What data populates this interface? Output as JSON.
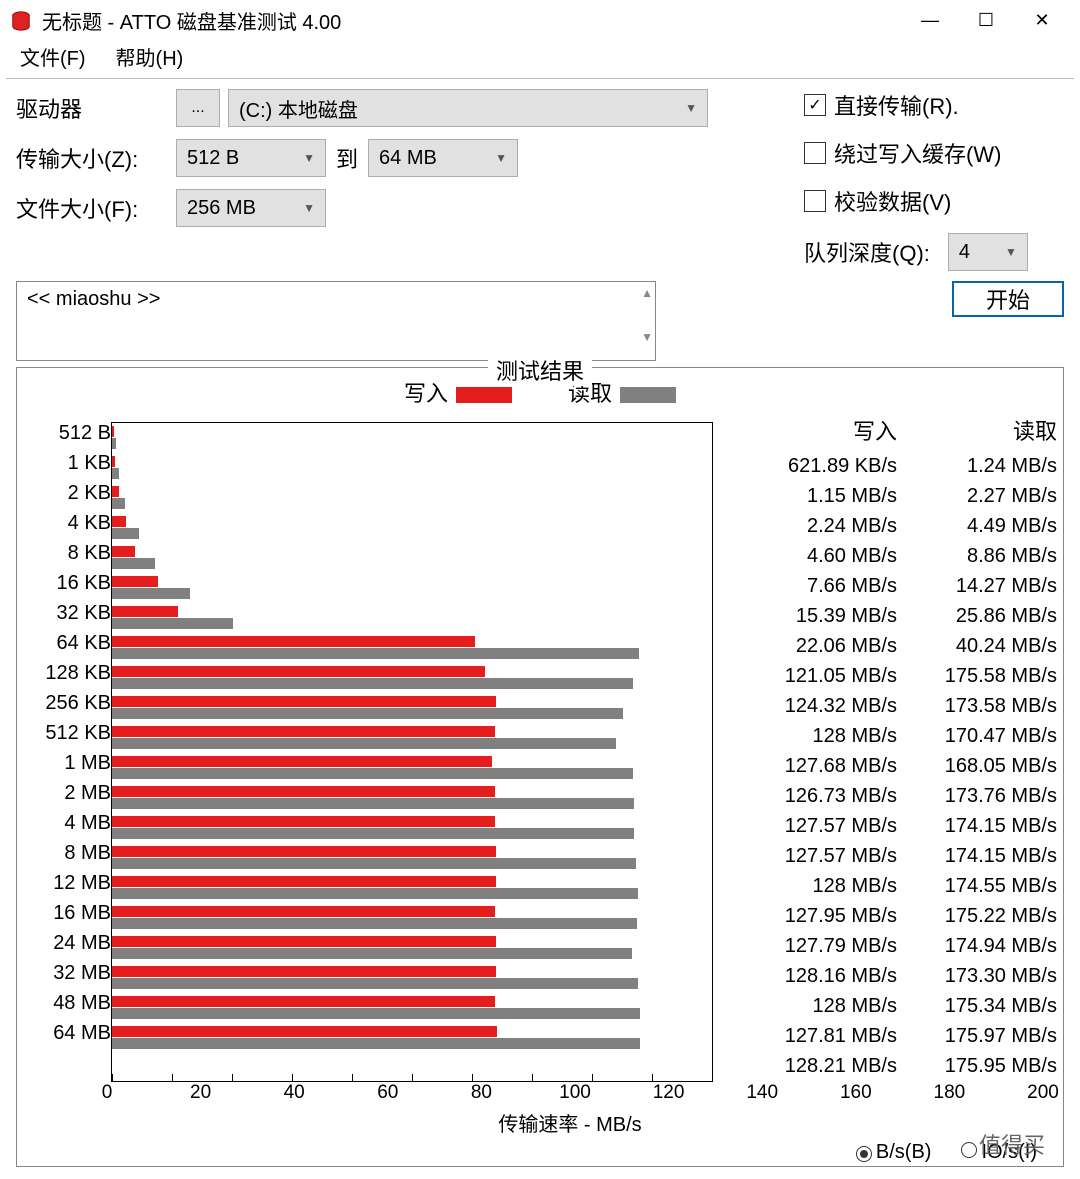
{
  "title": "无标题 - ATTO 磁盘基准测试 4.00",
  "menu": {
    "file": "文件(F)",
    "help": "帮助(H)"
  },
  "labels": {
    "drive": "驱动器",
    "transfer_size": "传输大小(Z):",
    "file_size": "文件大小(F):",
    "to": "到",
    "direct": "直接传输(R).",
    "bypass": "绕过写入缓存(W)",
    "verify": "校验数据(V)",
    "queue_depth": "队列深度(Q):",
    "start": "开始",
    "desc_placeholder": "<< miaoshu >>",
    "results_title": "测试结果",
    "legend_write": "写入",
    "legend_read": "读取",
    "x_axis": "传输速率 - MB/s",
    "units_bs": "B/s(B)",
    "units_ios": "IO/s(I)"
  },
  "values": {
    "drive": "(C:) 本地磁盘",
    "ts_from": "512 B",
    "ts_to": "64 MB",
    "file_size": "256 MB",
    "queue_depth": "4",
    "direct_checked": true,
    "bypass_checked": false,
    "verify_checked": false,
    "units_selected": "bs"
  },
  "chart_data": {
    "type": "bar",
    "orientation": "horizontal",
    "xlabel": "传输速率 - MB/s",
    "xlim": [
      0,
      200
    ],
    "xticks": [
      0,
      20,
      40,
      60,
      80,
      100,
      120,
      140,
      160,
      180,
      200
    ],
    "categories": [
      "512 B",
      "1 KB",
      "2 KB",
      "4 KB",
      "8 KB",
      "16 KB",
      "32 KB",
      "64 KB",
      "128 KB",
      "256 KB",
      "512 KB",
      "1 MB",
      "2 MB",
      "4 MB",
      "8 MB",
      "12 MB",
      "16 MB",
      "24 MB",
      "32 MB",
      "48 MB",
      "64 MB"
    ],
    "series": [
      {
        "name": "写入",
        "color": "#e51d1d",
        "values_mb_s": [
          0.607,
          1.15,
          2.24,
          4.6,
          7.66,
          15.39,
          22.06,
          121.05,
          124.32,
          128.0,
          127.68,
          126.73,
          127.57,
          127.57,
          128.0,
          127.95,
          127.79,
          128.16,
          128.0,
          127.81,
          128.21
        ],
        "display": [
          "621.89 KB/s",
          "1.15 MB/s",
          "2.24 MB/s",
          "4.60 MB/s",
          "7.66 MB/s",
          "15.39 MB/s",
          "22.06 MB/s",
          "121.05 MB/s",
          "124.32 MB/s",
          "128 MB/s",
          "127.68 MB/s",
          "126.73 MB/s",
          "127.57 MB/s",
          "127.57 MB/s",
          "128 MB/s",
          "127.95 MB/s",
          "127.79 MB/s",
          "128.16 MB/s",
          "128 MB/s",
          "127.81 MB/s",
          "128.21 MB/s"
        ]
      },
      {
        "name": "读取",
        "color": "#808080",
        "values_mb_s": [
          1.24,
          2.27,
          4.49,
          8.86,
          14.27,
          25.86,
          40.24,
          175.58,
          173.58,
          170.47,
          168.05,
          173.76,
          174.15,
          174.15,
          174.55,
          175.22,
          174.94,
          173.3,
          175.34,
          175.97,
          175.95
        ],
        "display": [
          "1.24 MB/s",
          "2.27 MB/s",
          "4.49 MB/s",
          "8.86 MB/s",
          "14.27 MB/s",
          "25.86 MB/s",
          "40.24 MB/s",
          "175.58 MB/s",
          "173.58 MB/s",
          "170.47 MB/s",
          "168.05 MB/s",
          "173.76 MB/s",
          "174.15 MB/s",
          "174.15 MB/s",
          "174.55 MB/s",
          "175.22 MB/s",
          "174.94 MB/s",
          "173.30 MB/s",
          "175.34 MB/s",
          "175.97 MB/s",
          "175.95 MB/s"
        ]
      }
    ]
  },
  "watermark": "值得买"
}
